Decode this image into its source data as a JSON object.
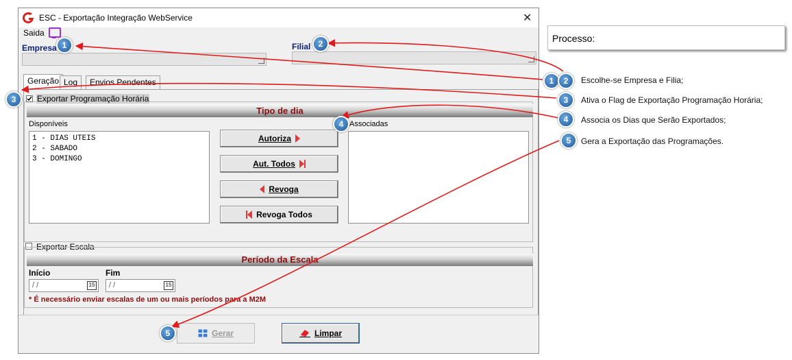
{
  "window": {
    "title": "ESC - Exportação Integração WebService",
    "close_glyph": "✕"
  },
  "menu": {
    "saida": "Saida"
  },
  "empresa": {
    "label": "Empresa"
  },
  "filial": {
    "label": "Filial"
  },
  "tabs": [
    {
      "label": "Geração"
    },
    {
      "label": "Log"
    },
    {
      "label": "Envios Pendentes"
    }
  ],
  "exportar_programacao": {
    "label": "Exportar Programação Horária",
    "checked": true
  },
  "tipo_dia": {
    "title": "Tipo de dia",
    "disponiveis_label": "Disponíveis",
    "associadas_label": "Associadas",
    "disponiveis": [
      "1 - DIAS UTEIS",
      "2 - SABADO",
      "3 - DOMINGO"
    ],
    "buttons": {
      "autoriza": "Autoriza",
      "aut_todos": "Aut. Todos",
      "revoga": "Revoga",
      "revoga_todos": "Revoga Todos"
    }
  },
  "exportar_escala": {
    "label": "Exportar Escala",
    "checked": false
  },
  "periodo": {
    "title": "Período da Escala",
    "inicio_label": "Início",
    "fim_label": "Fim",
    "inicio_value": "/ /",
    "fim_value": "/ /",
    "cal_glyph": "15",
    "warning": "* É necessário enviar escalas de um ou mais períodos para a M2M"
  },
  "footer": {
    "gerar": "Gerar",
    "limpar": "Limpar"
  },
  "process": {
    "title": "Processo:",
    "steps": [
      "Escolhe-se Empresa e Filia;",
      "Ativa o Flag de Exportação Programação Horária;",
      "Associa os Dias que Serão Exportados;",
      "Gera a Exportação das Programações."
    ]
  },
  "badges": [
    "1",
    "2",
    "3",
    "4",
    "5"
  ],
  "colors": {
    "accent_red": "#e01b1b",
    "badge_blue": "#2a6fb5",
    "title_dark_red": "#8b0e0e",
    "label_blue": "#0b1e7a"
  }
}
